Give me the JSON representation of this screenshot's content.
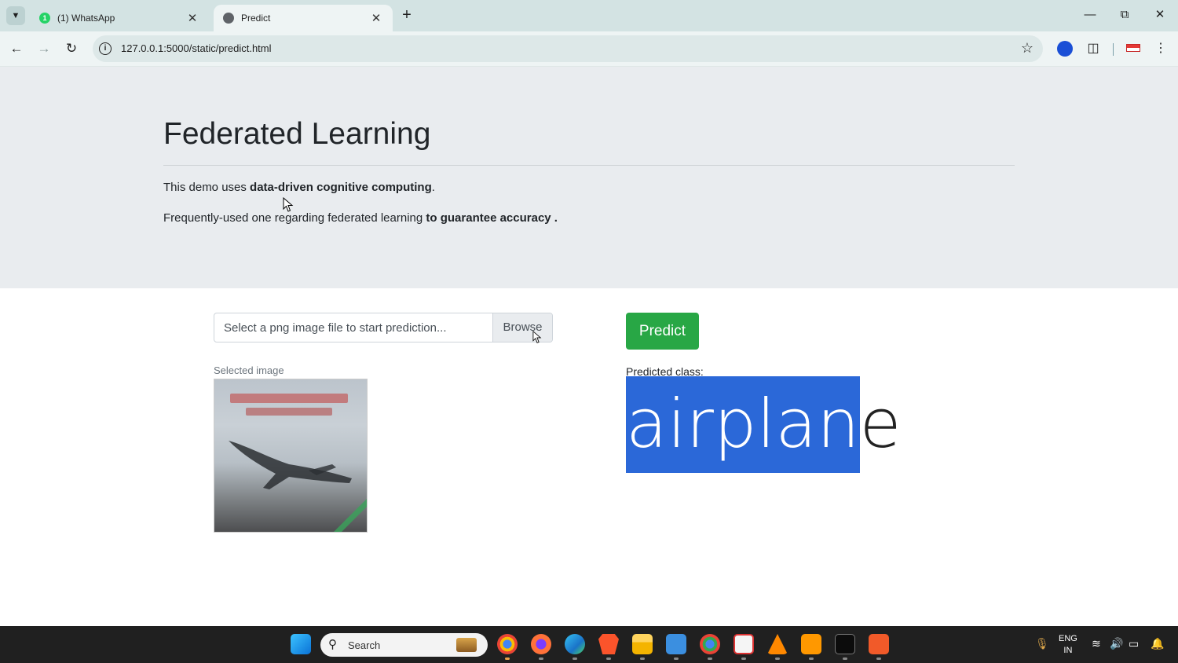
{
  "browser": {
    "tabs": [
      {
        "title": "(1) WhatsApp",
        "icon": "whatsapp-icon",
        "active": false
      },
      {
        "title": "Predict",
        "icon": "globe-icon",
        "active": true
      }
    ],
    "url": "127.0.0.1:5000/static/predict.html"
  },
  "jumbotron": {
    "title": "Federated Learning",
    "line1_prefix": "This demo uses ",
    "line1_bold": "data-driven cognitive computing",
    "line1_suffix": ".",
    "line2_prefix": "Frequently-used one regarding federated learning ",
    "line2_bold": "to guarantee accuracy ."
  },
  "upload": {
    "placeholder": "Select a png image file to start prediction...",
    "browse_label": "Browse"
  },
  "predict_button": "Predict",
  "selected_image_label": "Selected image",
  "prediction": {
    "label": "Predicted class:",
    "class_selected": "airplan",
    "class_rest": "e"
  },
  "taskbar": {
    "search_placeholder": "Search",
    "lang_line1": "ENG",
    "lang_line2": "IN"
  },
  "colors": {
    "predict_button": "#28a745",
    "jumbotron_bg": "#e9ecef",
    "selection": "#2b68d8",
    "tabstrip": "#d3e3e3"
  }
}
